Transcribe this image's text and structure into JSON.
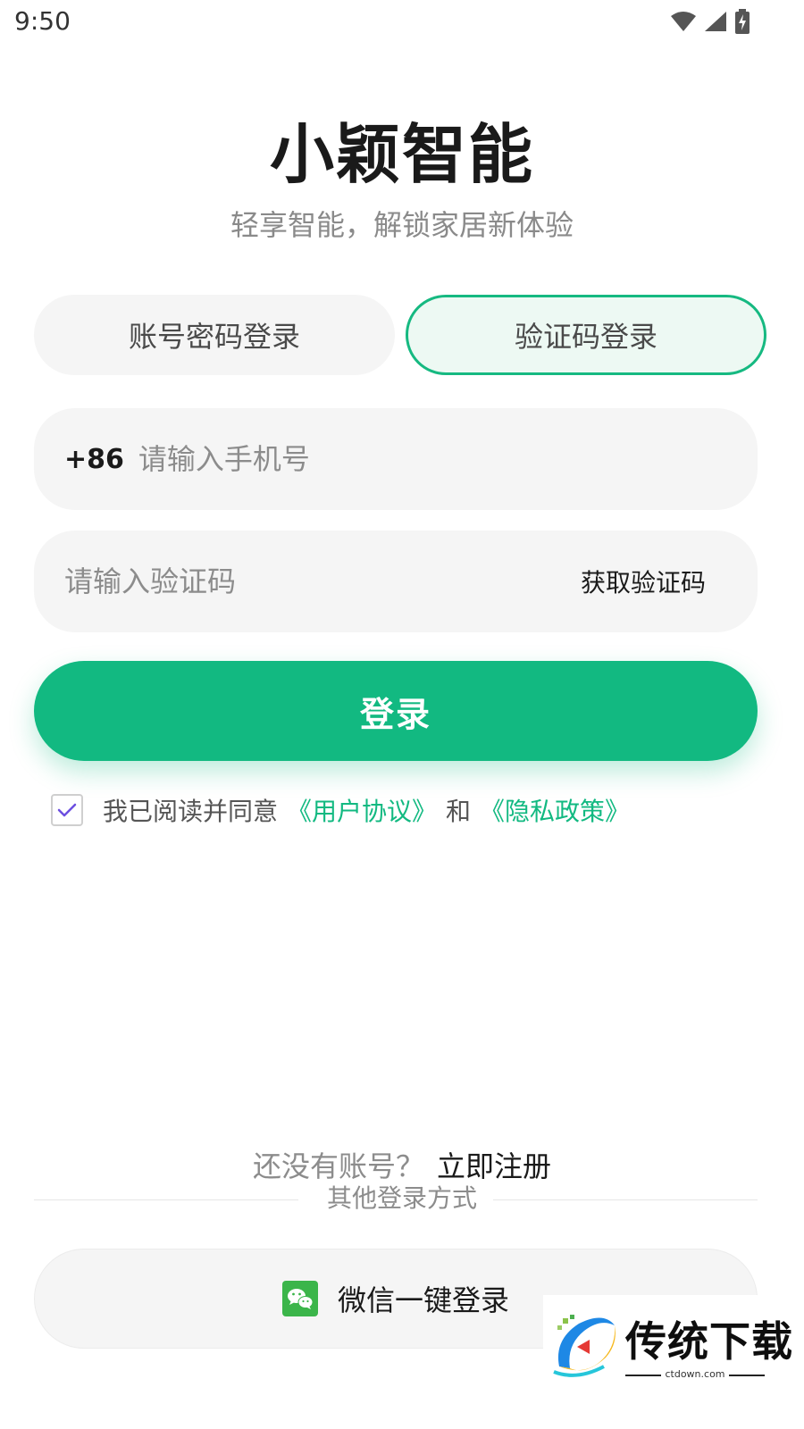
{
  "status_bar": {
    "time": "9:50"
  },
  "header": {
    "title": "小颖智能",
    "subtitle": "轻享智能，解锁家居新体验"
  },
  "tabs": [
    {
      "label": "账号密码登录",
      "selected": false
    },
    {
      "label": "验证码登录",
      "selected": true
    }
  ],
  "phone_field": {
    "prefix": "+86",
    "placeholder": "请输入手机号",
    "value": ""
  },
  "code_field": {
    "placeholder": "请输入验证码",
    "value": "",
    "get_code_label": "获取验证码"
  },
  "login_button": {
    "label": "登录"
  },
  "agreement": {
    "checked": true,
    "text": "我已阅读并同意",
    "user_agreement": "《用户协议》",
    "and": "和",
    "privacy_policy": "《隐私政策》"
  },
  "register": {
    "prompt": "还没有账号？",
    "link": "立即注册"
  },
  "other_login": {
    "label": "其他登录方式",
    "wechat_label": "微信一键登录"
  },
  "watermark": {
    "text": "传统下载",
    "sub": "ctdown.com"
  },
  "colors": {
    "accent": "#12b981",
    "tab_selected_bg": "#edf9f3",
    "field_bg": "#f5f5f5",
    "wechat_green": "#3bb54a",
    "checkmark": "#6c4fe0"
  },
  "icons": [
    "wifi-icon",
    "signal-icon",
    "battery-charging-icon",
    "check-icon",
    "wechat-icon",
    "watermark-logo-icon"
  ]
}
